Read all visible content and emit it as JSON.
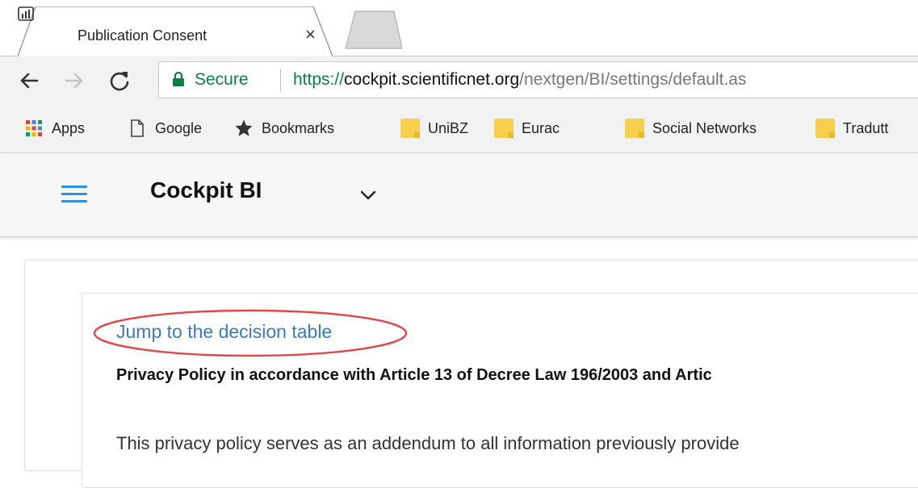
{
  "browser": {
    "tab": {
      "title": "Publication Consent",
      "close_glyph": "×"
    },
    "security_label": "Secure",
    "url": {
      "scheme": "https://",
      "host": "cockpit.scientificnet.org",
      "path": "/nextgen/BI/settings/default.as"
    },
    "bookmarks": [
      {
        "label": "Apps",
        "icon": "apps-grid-icon"
      },
      {
        "label": "Google",
        "icon": "page-icon"
      },
      {
        "label": "Bookmarks",
        "icon": "star-icon"
      },
      {
        "label": "UniBZ",
        "icon": "folder-icon"
      },
      {
        "label": "Eurac",
        "icon": "folder-icon"
      },
      {
        "label": "Social Networks",
        "icon": "folder-icon"
      },
      {
        "label": "Tradutt",
        "icon": "folder-icon"
      }
    ]
  },
  "app": {
    "title": "Cockpit BI"
  },
  "content": {
    "jump_link": "Jump to the decision table",
    "policy_heading": "Privacy Policy in accordance with Article 13 of Decree Law 196/2003 and Artic",
    "policy_text": "This privacy policy serves as an addendum to all information previously provide"
  },
  "colors": {
    "secure_green": "#0b8043",
    "link_blue": "#3a7bbf",
    "hamburger_blue": "#2d8fe2",
    "annotation_red": "#e04848",
    "folder_yellow": "#f7cf4d"
  }
}
